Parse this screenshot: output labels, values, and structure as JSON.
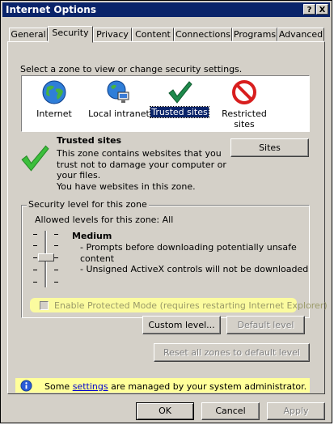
{
  "window": {
    "title": "Internet Options",
    "help_button": "?",
    "close_button": "X"
  },
  "tabs": [
    {
      "label": "General",
      "active": false
    },
    {
      "label": "Security",
      "active": true
    },
    {
      "label": "Privacy",
      "active": false
    },
    {
      "label": "Content",
      "active": false
    },
    {
      "label": "Connections",
      "active": false
    },
    {
      "label": "Programs",
      "active": false
    },
    {
      "label": "Advanced",
      "active": false
    }
  ],
  "zones": {
    "prompt": "Select a zone to view or change security settings.",
    "items": [
      {
        "label": "Internet",
        "icon": "globe-icon",
        "selected": false
      },
      {
        "label": "Local intranet",
        "icon": "intranet-icon",
        "selected": false
      },
      {
        "label": "Trusted sites",
        "icon": "checkmark-icon",
        "selected": true
      },
      {
        "label": "Restricted sites",
        "icon": "restricted-icon",
        "selected": false
      }
    ]
  },
  "zone_info": {
    "title": "Trusted sites",
    "description_lines": [
      "This zone contains websites that you",
      "trust not to damage your computer or",
      "your files.",
      "You have websites in this zone."
    ],
    "sites_button": "Sites"
  },
  "security_level": {
    "group_title": "Security level for this zone",
    "allowed_levels": "Allowed levels for this zone: All",
    "level_name": "Medium",
    "level_value": "Medium",
    "details": [
      "- Prompts before downloading potentially unsafe",
      "content",
      "- Unsigned ActiveX controls will not be downloaded"
    ],
    "protected_mode_label": "Enable Protected Mode (requires restarting Internet Explorer)",
    "protected_mode_checked": false,
    "custom_level_button": "Custom level...",
    "default_level_button": "Default level"
  },
  "reset_button": "Reset all zones to default level",
  "admin_notice": {
    "prefix": "Some ",
    "link": "settings",
    "suffix": " are managed by your system administrator."
  },
  "footer": {
    "ok": "OK",
    "cancel": "Cancel",
    "apply": "Apply"
  },
  "colors": {
    "titlebar": "#0a246a",
    "face": "#d4d0c8",
    "highlight_yellow": "#ffff9a",
    "link": "#0000cc",
    "selection": "#0a246a"
  }
}
